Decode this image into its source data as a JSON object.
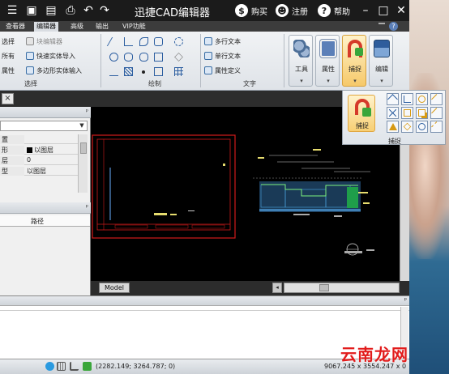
{
  "titlebar": {
    "app_title": "迅捷CAD编辑器",
    "buy_label": "购买",
    "register_label": "注册",
    "help_label": "帮助",
    "buy_icon": "$",
    "register_icon": "&#9787;",
    "help_icon": "?"
  },
  "tabs": [
    "查看器",
    "编辑器",
    "高级",
    "输出",
    "VIP功能"
  ],
  "active_tab": "编辑器",
  "ribbon": {
    "select_group": {
      "items": [
        "选择",
        "所有",
        "属性"
      ],
      "label": "选择"
    },
    "block_group": {
      "items": [
        "块编辑器",
        "快速实体导入",
        "多边形实体输入"
      ]
    },
    "draw_group": {
      "label": "绘制"
    },
    "text_group": {
      "items": [
        "多行文本",
        "单行文本",
        "属性定义"
      ],
      "label": "文字"
    },
    "big_buttons": [
      "工具",
      "属性",
      "捕捉",
      "编辑"
    ],
    "caret": "▾"
  },
  "snap_popup": {
    "main_label": "捕捉",
    "group_label": "捕捉"
  },
  "doc_close": "×",
  "properties_panel": {
    "rows": [
      {
        "key": "置",
        "value": ""
      },
      {
        "key": "形",
        "value": "以图层"
      },
      {
        "key": "层",
        "value": "0"
      },
      {
        "key": "型",
        "value": "以图层"
      }
    ],
    "path_header": "路径",
    "pin": "ᵖ"
  },
  "model_tab": "Model",
  "status": {
    "coords": "(2282.149; 3264.787; 0)",
    "extents": "9067.245 x 3554.247 x 0"
  },
  "watermark": "云南龙网",
  "colors": {
    "titlebar": "#1b1b1b",
    "canvas": "#000000",
    "drawing_frame": "#d11a1a",
    "accent_green": "#3aa63a"
  }
}
